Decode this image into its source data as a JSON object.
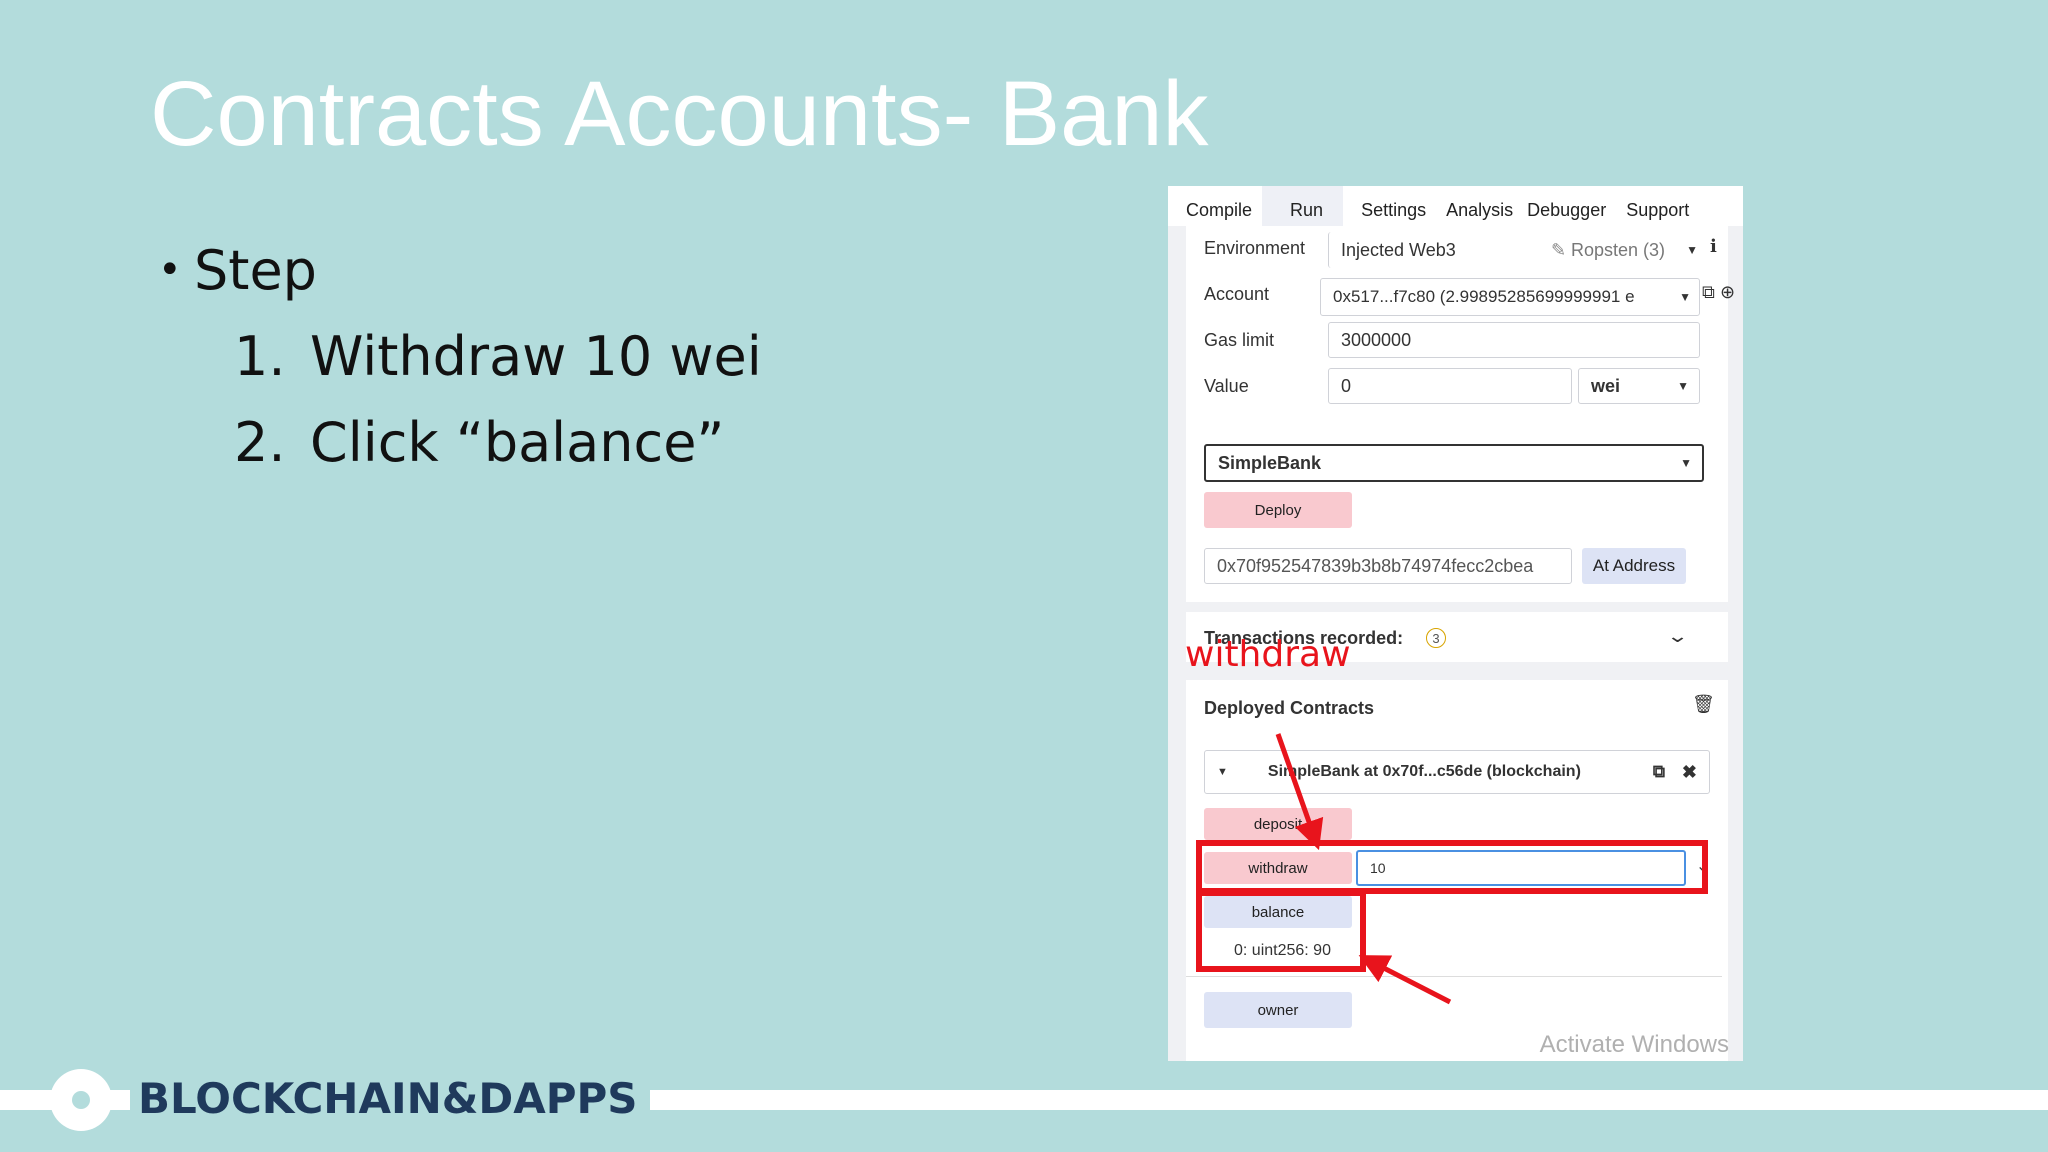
{
  "slide": {
    "title": "Contracts Accounts- Bank",
    "bullet": "Step",
    "steps": [
      {
        "num": "1.",
        "text": "Withdraw 10 wei"
      },
      {
        "num": "2.",
        "text": "Click “balance”"
      }
    ]
  },
  "remix": {
    "tabs": [
      "Compile",
      "Run",
      "Settings",
      "Analysis",
      "Debugger",
      "Support"
    ],
    "active_tab": "Run",
    "environment_label": "Environment",
    "environment_value": "Injected Web3",
    "network": "Ropsten (3)",
    "account_label": "Account",
    "account_value": "0x517...f7c80 (2.99895285699999991 e",
    "gas_limit_label": "Gas limit",
    "gas_limit_value": "3000000",
    "value_label": "Value",
    "value_value": "0",
    "value_unit": "wei",
    "contract_select": "SimpleBank",
    "deploy_label": "Deploy",
    "at_address_value": "0x70f952547839b3b8b74974fecc2cbea",
    "at_address_label": "At Address",
    "transactions_label": "Transactions recorded:",
    "transactions_count": "3",
    "deployed_contracts_label": "Deployed Contracts",
    "instance_label": "SimpleBank at 0x70f...c56de (blockchain)",
    "deposit_label": "deposit",
    "withdraw_label": "withdraw",
    "withdraw_input": "10",
    "balance_label": "balance",
    "balance_result": "0: uint256: 90",
    "owner_label": "owner",
    "watermark": "Activate Windows"
  },
  "annotation": {
    "text": "withdraw",
    "color": "#e8141c"
  },
  "footer": {
    "brand": "BLOCKCHAIN&DAPPS"
  },
  "colors": {
    "background": "#b3dcdc",
    "title": "#ffffff",
    "brand": "#1f3a5c",
    "pink_button": "#f9c9cf",
    "blue_button": "#dde3f5",
    "highlight_red": "#e8141c"
  }
}
